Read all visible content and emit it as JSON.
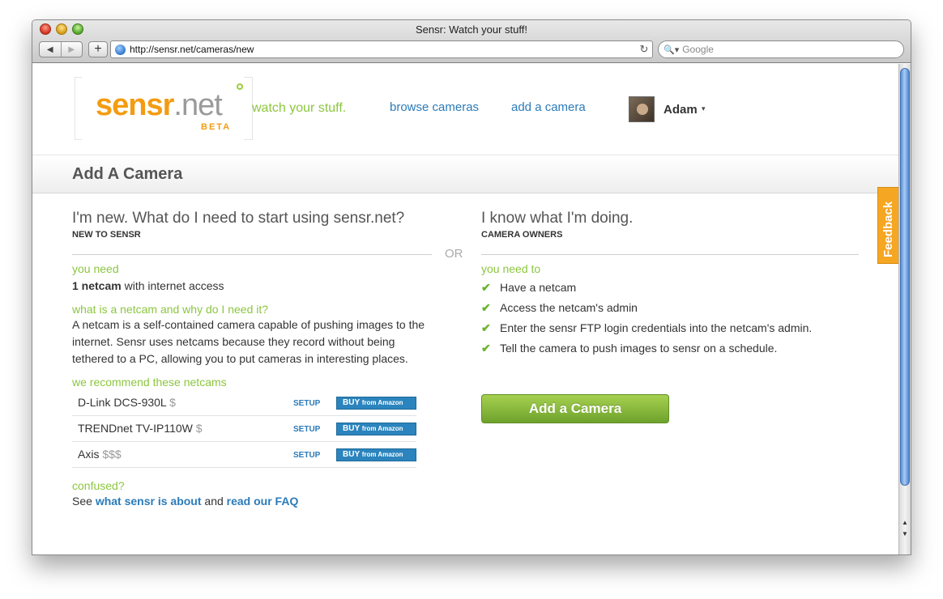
{
  "browser": {
    "title": "Sensr: Watch your stuff!",
    "url": "http://sensr.net/cameras/new",
    "search_placeholder": "Google",
    "back_glyph": "◀",
    "forward_glyph": "▶",
    "add_glyph": "+",
    "reload_glyph": "↻",
    "search_glyph": "🔍▾"
  },
  "header": {
    "logo_main": "sensr",
    "logo_net": ".net",
    "logo_beta": "BETA",
    "tagline": "watch your stuff.",
    "nav": [
      "browse cameras",
      "add a camera"
    ],
    "user": "Adam",
    "caret": "▾"
  },
  "page": {
    "title": "Add A Camera",
    "feedback": "Feedback",
    "or_text": "OR"
  },
  "left": {
    "heading": "I'm new. What do I need to start using sensr.net?",
    "sub": "NEW TO SENSR",
    "need_label": "you need",
    "need_bold": "1 netcam",
    "need_rest": " with internet access",
    "what_label": "what is a netcam and why do I need it?",
    "what_text": "A netcam is a self-contained camera capable of pushing images to the internet. Sensr uses netcams because they record without being tethered to a PC, allowing you to put cameras in interesting places.",
    "recommend_label": "we recommend these netcams",
    "cameras": [
      {
        "name": "D-Link DCS-930L",
        "price": "$",
        "setup": "SETUP",
        "buy": "BUY",
        "buy_small": "from Amazon"
      },
      {
        "name": "TRENDnet TV-IP110W",
        "price": "$",
        "setup": "SETUP",
        "buy": "BUY",
        "buy_small": "from Amazon"
      },
      {
        "name": "Axis",
        "price": "$$$",
        "setup": "SETUP",
        "buy": "BUY",
        "buy_small": "from Amazon"
      }
    ],
    "confused_label": "confused?",
    "see_text": "See ",
    "about_link": "what sensr is about",
    "and_text": " and ",
    "faq_link": "read our FAQ"
  },
  "right": {
    "heading": "I know what I'm doing.",
    "sub": "CAMERA OWNERS",
    "need_label": "you need to",
    "checks": [
      "Have a netcam",
      "Access the netcam's admin",
      "Enter the sensr FTP login credentials into the netcam's admin.",
      "Tell the camera to push images to sensr on a schedule."
    ],
    "check_glyph": "✔",
    "add_button": "Add a Camera"
  },
  "scroll": {
    "up_glyph": "▲",
    "down_glyph": "▼"
  }
}
